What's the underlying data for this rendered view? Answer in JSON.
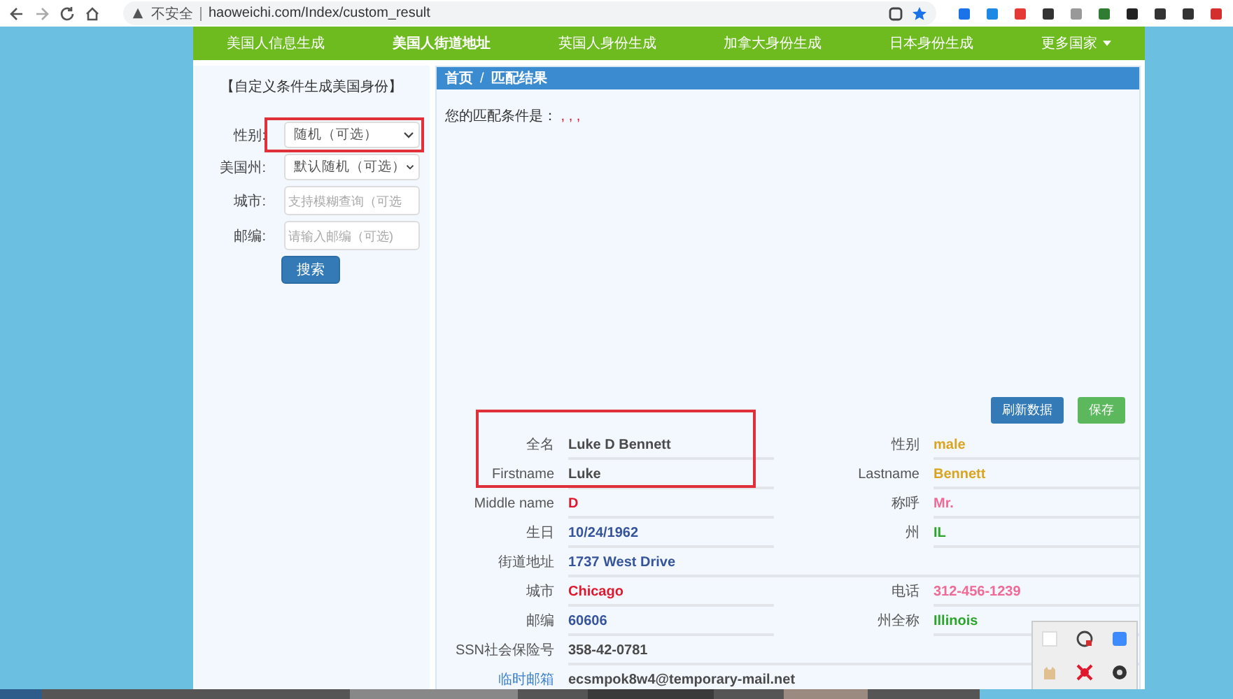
{
  "browser": {
    "security": "不安全",
    "url": "haoweichi.com/Index/custom_result"
  },
  "nav": [
    {
      "label": "美国人信息生成",
      "selected": false
    },
    {
      "label": "美国人街道地址",
      "selected": true
    },
    {
      "label": "英国人身份生成",
      "selected": false
    },
    {
      "label": "加拿大身份生成",
      "selected": false
    },
    {
      "label": "日本身份生成",
      "selected": false
    },
    {
      "label": "更多国家",
      "selected": false,
      "kind": "dropdown"
    }
  ],
  "sidebar": {
    "title": "【自定义条件生成美国身份】",
    "fields": [
      {
        "label": "性别:",
        "kind": "select",
        "value": "随机（可选）",
        "highlighted": true
      },
      {
        "label": "美国州:",
        "kind": "select",
        "value": "默认随机（可选）",
        "highlighted": false
      },
      {
        "label": "城市:",
        "kind": "input",
        "placeholder": "支持模糊查询（可选",
        "highlighted": false
      },
      {
        "label": "邮编:",
        "kind": "input",
        "placeholder": "请输入邮编（可选)",
        "highlighted": false
      }
    ],
    "search_button": "搜索"
  },
  "panel": {
    "breadcrumb": [
      "首页",
      "/",
      "匹配结果"
    ],
    "condition_label": "您的匹配条件是：",
    "condition_value": ", , ,",
    "buttons": [
      {
        "label": "刷新数据",
        "kind": "primary"
      },
      {
        "label": "保存",
        "kind": "success"
      }
    ],
    "rows": [
      {
        "cells": [
          {
            "label": "全名",
            "value": "Luke D Bennett",
            "color": "#4a4a4a"
          },
          {
            "label": "性别",
            "value": "male",
            "color": "#d9a521"
          }
        ]
      },
      {
        "cells": [
          {
            "label": "Firstname",
            "value": "Luke",
            "color": "#4a4a4a"
          },
          {
            "label": "Lastname",
            "value": "Bennett",
            "color": "#d9a521"
          }
        ]
      },
      {
        "cells": [
          {
            "label": "Middle name",
            "value": "D",
            "color": "#e0182d"
          },
          {
            "label": "称呼",
            "value": "Mr.",
            "color": "#f06a95"
          }
        ]
      },
      {
        "cells": [
          {
            "label": "生日",
            "value": "10/24/1962",
            "color": "#35549c"
          },
          {
            "label": "州",
            "value": "IL",
            "color": "#2aa52a"
          }
        ]
      },
      {
        "cells": [
          {
            "label": "街道地址",
            "value": "1737 West Drive",
            "color": "#35549c"
          }
        ]
      },
      {
        "cells": [
          {
            "label": "城市",
            "value": "Chicago",
            "color": "#e0182d"
          },
          {
            "label": "电话",
            "value": "312-456-1239",
            "color": "#f06a95"
          }
        ]
      },
      {
        "cells": [
          {
            "label": "邮编",
            "value": "60606",
            "color": "#35549c"
          },
          {
            "label": "州全称",
            "value": "Illinois",
            "color": "#2aa52a"
          }
        ]
      },
      {
        "cells": [
          {
            "label": "SSN社会保险号",
            "value": "358-42-0781",
            "color": "#4a4a4a"
          }
        ]
      },
      {
        "cells": [
          {
            "label": "临时邮箱",
            "value": "ecsmpok8w4@temporary-mail.net",
            "color": "#4a4a4a",
            "kind": "link"
          }
        ]
      }
    ],
    "highlighted_rows": true
  }
}
